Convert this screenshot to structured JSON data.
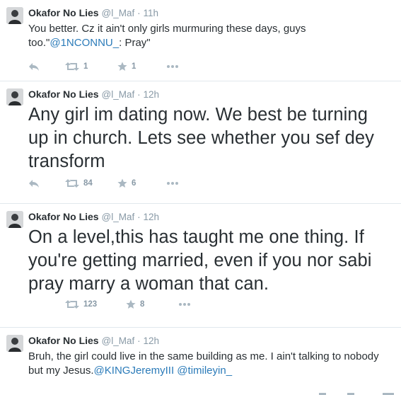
{
  "tweets": [
    {
      "name": "Okafor No Lies",
      "handle": "@l_Maf",
      "time": "11h",
      "text_before": "You better. Cz it ain't only girls murmuring these days, guys too.\"",
      "link1": "@1NCONNU_",
      "text_after": ": Pray\"",
      "retweets": "1",
      "favorites": "1"
    },
    {
      "name": "Okafor No Lies",
      "handle": "@l_Maf",
      "time": "12h",
      "text": "Any girl im dating now. We best be turning up in church. Lets see whether you sef dey transform",
      "retweets": "84",
      "favorites": "6"
    },
    {
      "name": "Okafor No Lies",
      "handle": "@l_Maf",
      "time": "12h",
      "text": "On a level,this has taught me one thing. If you're getting married, even if you nor sabi pray marry a woman that can.",
      "retweets": "123",
      "favorites": "8"
    },
    {
      "name": "Okafor No Lies",
      "handle": "@l_Maf",
      "time": "12h",
      "text_before": "Bruh, the girl could live in the same building as me. I ain't talking to nobody but my Jesus.",
      "link1": "@KINGJeremyIII",
      "link2": "@timileyin_"
    }
  ],
  "colors": {
    "text": "#292f33",
    "meta": "#8899a6",
    "link": "#2b7bb9",
    "divider": "#e1e8ed",
    "action_icon": "#aab8c2"
  },
  "icons": [
    "reply-icon",
    "retweet-icon",
    "favorite-star-icon",
    "more-dots-icon",
    "avatar"
  ]
}
